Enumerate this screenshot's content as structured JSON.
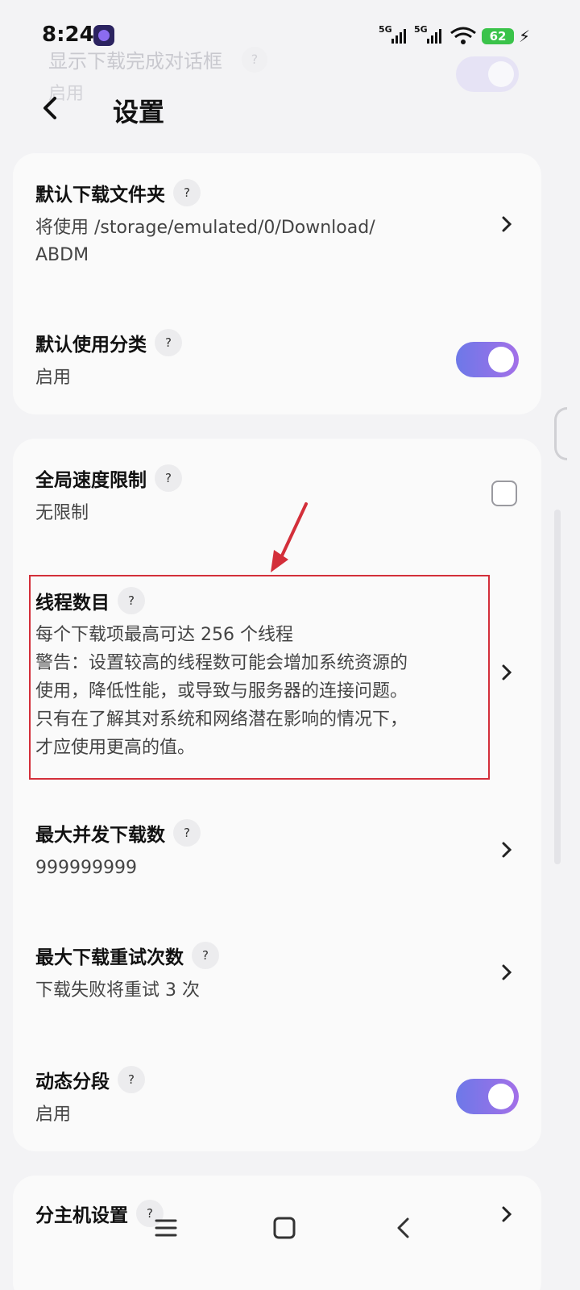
{
  "status": {
    "time": "8:24",
    "signal1": "5G",
    "signal2": "5G",
    "battery": "62"
  },
  "ghost": {
    "title": "显示下载完成对话框",
    "sub": "启用",
    "q": "?"
  },
  "header": {
    "title": "设置"
  },
  "card1": {
    "folder": {
      "title": "默认下载文件夹",
      "q": "?",
      "value_line1": "将使用 /storage/emulated/0/Download/",
      "value_line2": "ABDM"
    },
    "category": {
      "title": "默认使用分类",
      "q": "?",
      "value": "启用"
    }
  },
  "card2": {
    "speed": {
      "title": "全局速度限制",
      "q": "?",
      "value": "无限制"
    },
    "threads": {
      "title": "线程数目",
      "q": "?",
      "line1": "每个下载项最高可达 256 个线程",
      "line2": "警告：设置较高的线程数可能会增加系统资源的",
      "line3": "使用，降低性能，或导致与服务器的连接问题。",
      "line4": "只有在了解其对系统和网络潜在影响的情况下，",
      "line5": "才应使用更高的值。"
    },
    "concurrent": {
      "title": "最大并发下载数",
      "q": "?",
      "value": "999999999"
    },
    "retry": {
      "title": "最大下载重试次数",
      "q": "?",
      "value": "下载失败将重试 3 次"
    },
    "segment": {
      "title": "动态分段",
      "q": "?",
      "value": "启用"
    }
  },
  "card3": {
    "host": {
      "title": "分主机设置",
      "q": "?"
    }
  },
  "colors": {
    "accent_start": "#6d78e8",
    "accent_end": "#a370e8",
    "highlight": "#d32f3a"
  },
  "icons": {
    "back": "back-arrow-icon",
    "chevron": "chevron-right-icon",
    "menu": "menu-icon",
    "home": "home-icon",
    "nav_back": "nav-back-icon"
  }
}
